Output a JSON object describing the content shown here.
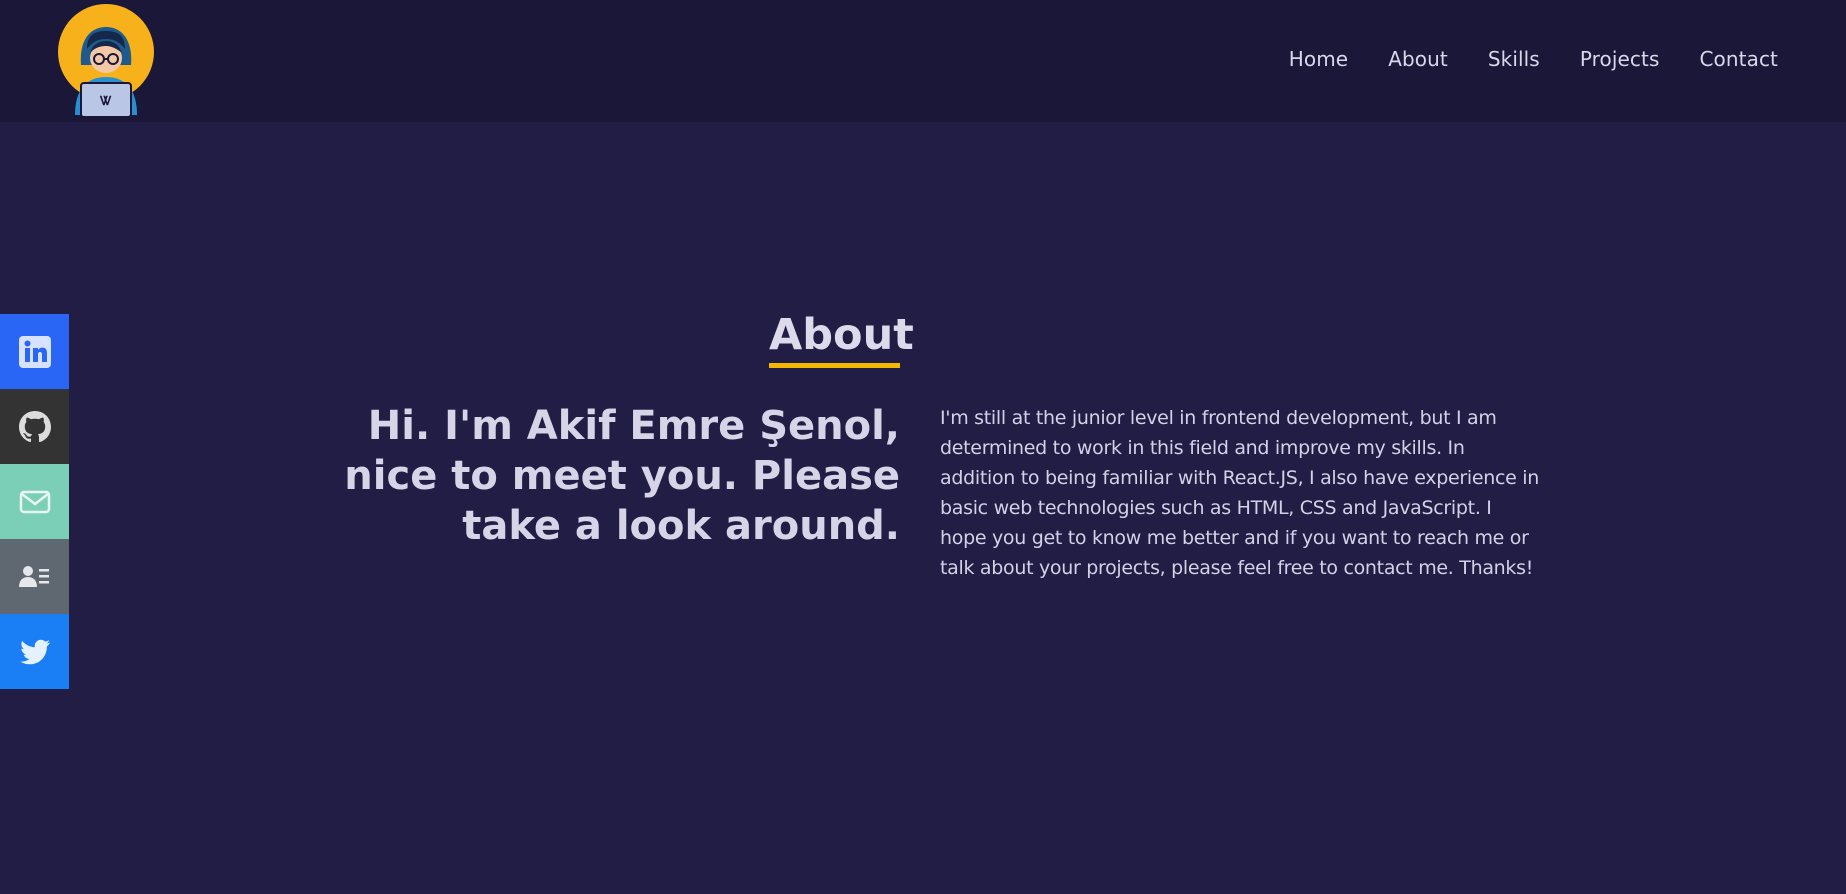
{
  "nav": {
    "logo_alt": "logo",
    "links": [
      "Home",
      "About",
      "Skills",
      "Projects",
      "Contact"
    ]
  },
  "social": [
    {
      "name": "linkedin",
      "icon": "linkedin-icon",
      "color": "#2a66f5"
    },
    {
      "name": "github",
      "icon": "github-icon",
      "color": "#333333"
    },
    {
      "name": "email",
      "icon": "mail-icon",
      "color": "#7ccfb7"
    },
    {
      "name": "resume",
      "icon": "contact-card-icon",
      "color": "#5f6870"
    },
    {
      "name": "twitter",
      "icon": "twitter-icon",
      "color": "#1a7ef5"
    }
  ],
  "about": {
    "title": "About",
    "hero_line1": "Hi. I'm Akif Emre Şenol,",
    "hero_line2": "nice to meet you. Please",
    "hero_line3": "take a look around.",
    "description": "I'm still at the junior level in frontend development, but I am determined to work in this field and improve my skills. In addition to being familiar with React.JS, I also have experience in basic web technologies such as HTML, CSS and JavaScript. I hope you get to know me better and if you want to reach me or talk about your projects, please feel free to contact me. Thanks!"
  },
  "colors": {
    "background": "#211d45",
    "navbar": "#1b1739",
    "accent": "#f5b800"
  }
}
